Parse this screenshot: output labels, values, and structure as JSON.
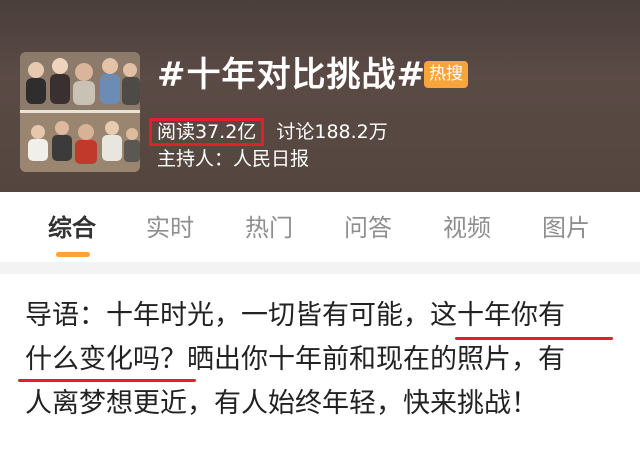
{
  "topic": {
    "title": "#十年对比挑战#",
    "badge": "热搜",
    "read_count": "阅读37.2亿",
    "discuss_count": "讨论188.2万",
    "host": "主持人：人民日报"
  },
  "tabs": [
    {
      "label": "综合",
      "active": true
    },
    {
      "label": "实时",
      "active": false
    },
    {
      "label": "热门",
      "active": false
    },
    {
      "label": "问答",
      "active": false
    },
    {
      "label": "视频",
      "active": false
    },
    {
      "label": "图片",
      "active": false
    }
  ],
  "intro": {
    "line1_a": "导语：十年时光，一切皆有可能，",
    "line1_b": "这十年你有",
    "line2_a": "什么变化吗？",
    "line2_b": "晒出你十年前和现在的照片，有",
    "line3": "人离梦想更近，有人始终年轻，快来挑战！"
  },
  "colors": {
    "header_bg": "#4f433f",
    "badge_bg": "#f7a53a",
    "highlight_red": "#e0202b",
    "tab_active": "#333333",
    "tab_inactive": "#8f8f8f",
    "accent_orange": "#f7a53a"
  }
}
